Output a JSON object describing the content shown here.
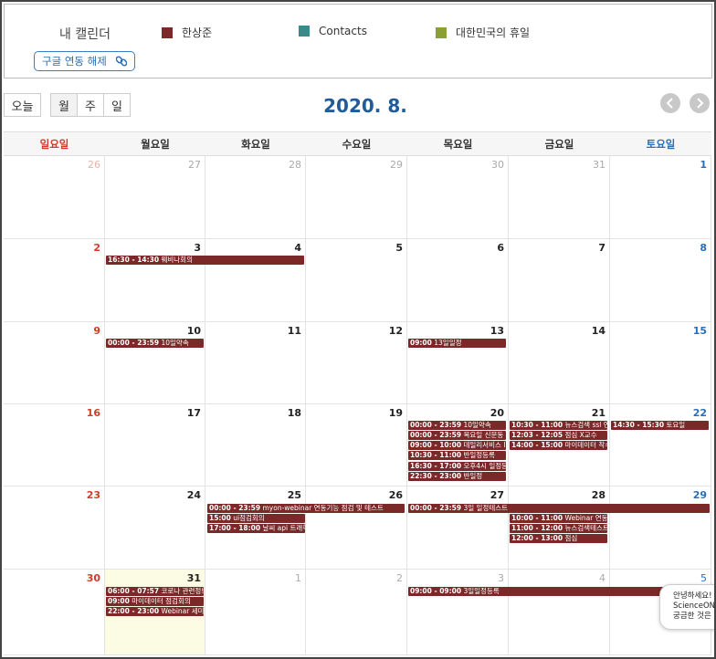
{
  "topbar": {
    "my_calendar": "내 캘린더",
    "legend": [
      {
        "label": "한상준",
        "color": "#7a2828"
      },
      {
        "label": "Contacts",
        "color": "#3a8a8a"
      },
      {
        "label": "대한민국의 휴일",
        "color": "#8aa033"
      }
    ],
    "unlink_label": "구글 연동 해제",
    "unlink_icon": "link-icon"
  },
  "toolbar": {
    "today": "오늘",
    "views": [
      "월",
      "주",
      "일"
    ],
    "active_view": "월",
    "title": "2020. 8.",
    "prev_icon": "chevron-left-icon",
    "next_icon": "chevron-right-icon"
  },
  "weekdays": [
    "일요일",
    "월요일",
    "화요일",
    "수요일",
    "목요일",
    "금요일",
    "토요일"
  ],
  "weeks": [
    [
      "26",
      "27",
      "28",
      "29",
      "30",
      "31",
      "1"
    ],
    [
      "2",
      "3",
      "4",
      "5",
      "6",
      "7",
      "8"
    ],
    [
      "9",
      "10",
      "11",
      "12",
      "13",
      "14",
      "15"
    ],
    [
      "16",
      "17",
      "18",
      "19",
      "20",
      "21",
      "22"
    ],
    [
      "23",
      "24",
      "25",
      "26",
      "27",
      "28",
      "29"
    ],
    [
      "30",
      "31",
      "1",
      "2",
      "3",
      "4",
      "5"
    ]
  ],
  "events": [
    {
      "time": "16:30 - 14:30",
      "title": "웨비나회의"
    },
    {
      "time": "00:00 - 23:59",
      "title": "10일약속"
    },
    {
      "time": "09:00",
      "title": "13일일정"
    },
    {
      "time": "00:00 - 23:59",
      "title": "10일약속"
    },
    {
      "time": "00:00 - 23:59",
      "title": "목요일 신문동 자"
    },
    {
      "time": "09:00 - 10:00",
      "title": "데일리서비스 IB"
    },
    {
      "time": "10:30 - 11:00",
      "title": "반일정등록"
    },
    {
      "time": "16:30 - 17:00",
      "title": "오후4시 일정등록"
    },
    {
      "time": "22:30 - 23:00",
      "title": "반일정"
    },
    {
      "time": "10:30 - 11:00",
      "title": "뉴스검색 ssl 연동"
    },
    {
      "time": "12:03 - 12:05",
      "title": "점심 X교수"
    },
    {
      "time": "14:00 - 15:00",
      "title": "마이데이터 착수"
    },
    {
      "time": "14:30 - 15:30",
      "title": "토요일"
    },
    {
      "time": "00:00 - 23:59",
      "title": "myon-webinar 연동기능 점검 및 테스트"
    },
    {
      "time": "15:00",
      "title": "ui점검회의"
    },
    {
      "time": "17:00 - 18:00",
      "title": "날씨 api 트래픽"
    },
    {
      "time": "00:00 - 23:59",
      "title": "3일 일정테스트"
    },
    {
      "time": "10:00 - 11:00",
      "title": "Webinar 연동 점"
    },
    {
      "time": "11:00 - 12:00",
      "title": "뉴스검색테스트"
    },
    {
      "time": "12:00 - 13:00",
      "title": "점심"
    },
    {
      "time": "06:00 - 07:57",
      "title": "코로나 관련정보"
    },
    {
      "time": "09:00",
      "title": "마이데이터 점검회의"
    },
    {
      "time": "22:00 - 23:00",
      "title": "Webinar 세미나"
    },
    {
      "time": "09:00 - 09:00",
      "title": "3일일정등록"
    }
  ],
  "popup": {
    "line1": "안녕하세요!",
    "line2": "ScienceON 챗",
    "line3": "궁금한 것은 저"
  }
}
